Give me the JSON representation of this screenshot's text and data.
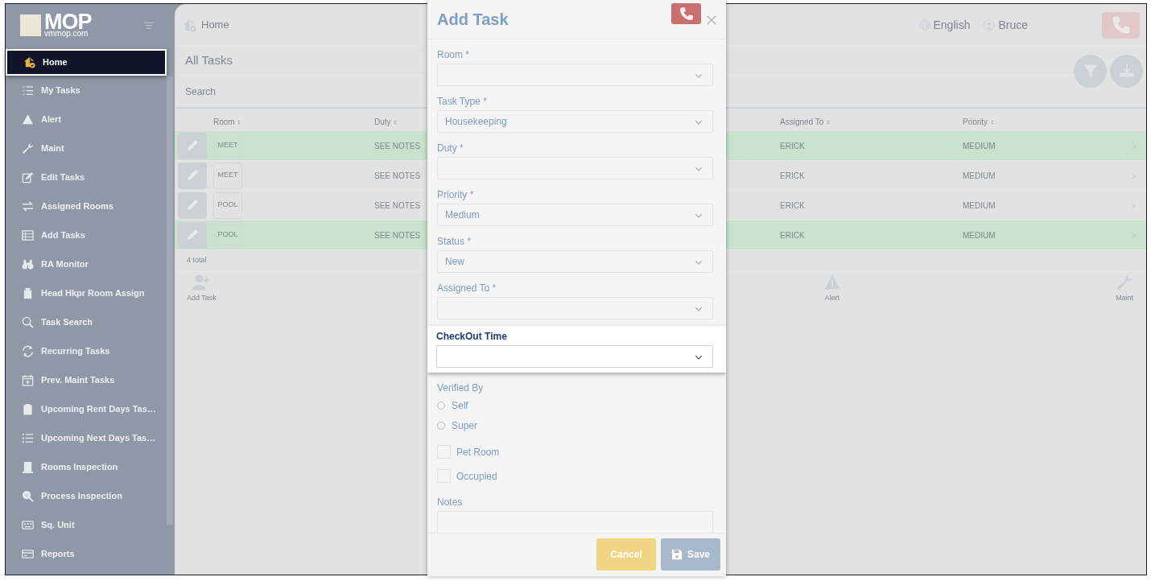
{
  "sidebar": {
    "logo": {
      "title": "MOP",
      "subtitle": "vmmop.com"
    },
    "items": [
      {
        "label": "Home",
        "selected": true
      },
      {
        "label": "My Tasks",
        "selected": false
      },
      {
        "label": "Alert",
        "selected": false
      },
      {
        "label": "Maint",
        "selected": false
      },
      {
        "label": "Edit Tasks",
        "selected": false
      },
      {
        "label": "Assigned Rooms",
        "selected": false
      },
      {
        "label": "Add Tasks",
        "selected": false
      },
      {
        "label": "RA Monitor",
        "selected": false
      },
      {
        "label": "Head Hkpr Room Assign",
        "selected": false
      },
      {
        "label": "Task Search",
        "selected": false
      },
      {
        "label": "Recurring Tasks",
        "selected": false
      },
      {
        "label": "Prev. Maint Tasks",
        "selected": false
      },
      {
        "label": "Upcoming Rent Days Tas…",
        "selected": false
      },
      {
        "label": "Upcoming Next Days Tas…",
        "selected": false
      },
      {
        "label": "Rooms Inspection",
        "selected": false
      },
      {
        "label": "Process Inspection",
        "selected": false
      },
      {
        "label": "Sq. Unit",
        "selected": false
      },
      {
        "label": "Reports",
        "selected": false
      }
    ]
  },
  "header": {
    "breadcrumb": "Home",
    "language": "English",
    "user": "Bruce"
  },
  "page": {
    "title": "All Tasks",
    "search": {
      "placeholder": "Search"
    }
  },
  "table": {
    "columns": [
      "Room",
      "Duty",
      "Assigned To",
      "Priority"
    ],
    "rows": [
      {
        "room": "MEET",
        "duty": "SEE NOTES",
        "assigned_to": "ERICK",
        "priority": "MEDIUM",
        "highlighted": true
      },
      {
        "room": "MEET",
        "duty": "SEE NOTES",
        "assigned_to": "ERICK",
        "priority": "MEDIUM",
        "highlighted": false
      },
      {
        "room": "POOL",
        "duty": "SEE NOTES",
        "assigned_to": "ERICK",
        "priority": "MEDIUM",
        "highlighted": false
      },
      {
        "room": "POOL",
        "duty": "SEE NOTES",
        "assigned_to": "ERICK",
        "priority": "MEDIUM",
        "highlighted": true
      }
    ],
    "footer": "4 total"
  },
  "actions": [
    {
      "label": "Add Task"
    },
    {
      "label": "Alert"
    },
    {
      "label": "Maint"
    }
  ],
  "dialog": {
    "title": "Add Task",
    "fields": [
      {
        "kind": "select",
        "label": "Room *",
        "focused": false
      },
      {
        "kind": "select",
        "label": "Task Type *",
        "value": "Housekeeping",
        "focused": false
      },
      {
        "kind": "select",
        "label": "Duty *",
        "focused": false
      },
      {
        "kind": "select",
        "label": "Priority *",
        "value": "Medium",
        "focused": false
      },
      {
        "kind": "select",
        "label": "Status *",
        "value": "New",
        "focused": false
      },
      {
        "kind": "select",
        "label": "Assigned To *",
        "focused": false
      },
      {
        "kind": "select",
        "label": "CheckOut Time",
        "focused": true
      },
      {
        "kind": "radio",
        "label": "Verified By",
        "options": [
          {
            "label": "Self",
            "selected": false
          },
          {
            "label": "Super",
            "selected": false
          }
        ]
      },
      {
        "kind": "checkbox",
        "label": "Pet Room",
        "checked": false
      },
      {
        "kind": "checkbox",
        "label": "Occupied",
        "checked": false
      },
      {
        "kind": "textarea",
        "label": "Notes"
      }
    ],
    "buttons": [
      {
        "kind": "cancel",
        "label": "Cancel"
      },
      {
        "kind": "save",
        "label": "Save"
      }
    ]
  }
}
